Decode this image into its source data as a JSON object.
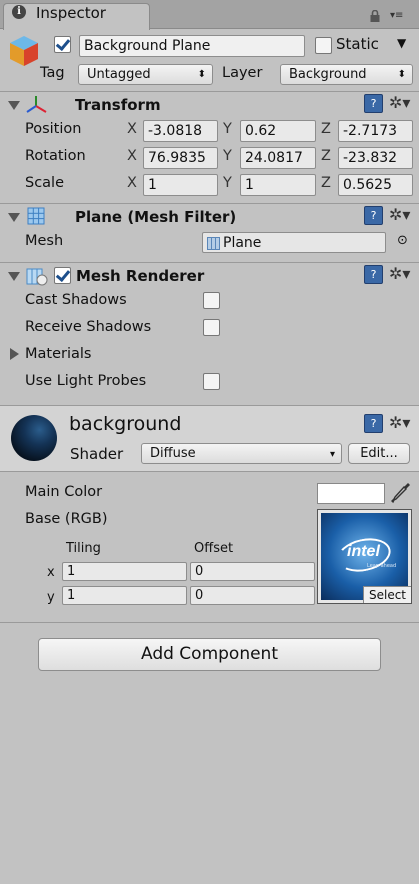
{
  "tab": {
    "label": "Inspector",
    "info_glyph": "i",
    "menu_glyph": "▾≡",
    "icon": "info-icon"
  },
  "object": {
    "name": "Background Plane",
    "active": true,
    "static_label": "Static",
    "static_checked": false,
    "tag_label": "Tag",
    "tag_value": "Untagged",
    "layer_label": "Layer",
    "layer_value": "Background"
  },
  "dropdown_arrow": "⬍",
  "transform": {
    "title": "Transform",
    "rows": [
      {
        "label": "Position",
        "x": "-3.0818",
        "y": "0.62",
        "z": "-2.7173"
      },
      {
        "label": "Rotation",
        "x": "76.9835",
        "y": "24.0817",
        "z": "-23.832"
      },
      {
        "label": "Scale",
        "x": "1",
        "y": "1",
        "z": "0.5625"
      }
    ],
    "axis_x": "X",
    "axis_y": "Y",
    "axis_z": "Z"
  },
  "mesh_filter": {
    "title": "Plane (Mesh Filter)",
    "mesh_label": "Mesh",
    "mesh_value": "Plane",
    "target_glyph": "⊙"
  },
  "mesh_renderer": {
    "title": "Mesh Renderer",
    "enabled": true,
    "cast_shadows_label": "Cast Shadows",
    "cast_shadows": false,
    "receive_shadows_label": "Receive Shadows",
    "receive_shadows": false,
    "materials_label": "Materials",
    "light_probes_label": "Use Light Probes",
    "light_probes": false
  },
  "material": {
    "name": "background",
    "shader_label": "Shader",
    "shader_value": "Diffuse",
    "shader_arrow": "▾",
    "edit_label": "Edit...",
    "main_color_label": "Main Color",
    "main_color": "#ffffff",
    "base_label": "Base (RGB)",
    "tiling_label": "Tiling",
    "offset_label": "Offset",
    "tiling_x": "1",
    "tiling_y": "1",
    "offset_x": "0",
    "offset_y": "0",
    "row_x": "x",
    "row_y": "y",
    "texture_logo": "intel",
    "texture_tagline": "Leap ahead",
    "select_label": "Select"
  },
  "help_glyph": "?",
  "gear_glyph": "✲▾",
  "add_component_label": "Add Component",
  "colors": {
    "panel_bg": "#c2c2c2",
    "help_blue": "#3a68a6",
    "texture_blue": "#1a5fa8"
  }
}
